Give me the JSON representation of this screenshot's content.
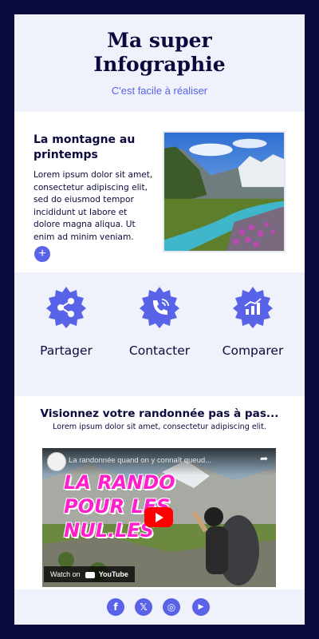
{
  "header": {
    "title_line1": "Ma super",
    "title_line2": "Infographie",
    "subtitle": "C'est facile à réaliser"
  },
  "article": {
    "title": "La montagne au printemps",
    "body": "Lorem ipsum dolor sit amet, consectetur adipiscing elit, sed do eiusmod tempor incididunt ut labore et dolore magna aliqua. Ut enim ad minim veniam.",
    "more_icon": "+"
  },
  "features": [
    {
      "label": "Partager",
      "icon": "share-icon"
    },
    {
      "label": "Contacter",
      "icon": "phone-icon"
    },
    {
      "label": "Comparer",
      "icon": "chart-icon"
    }
  ],
  "video_section": {
    "title": "Visionnez votre randonnée pas à pas...",
    "description": "Lorem ipsum dolor sit amet, consectetur adipiscing elit.",
    "video": {
      "channel_title": "La randonnée quand on y connaît queud...",
      "thumbnail_line1": "LA RANDO",
      "thumbnail_line2": "POUR LES",
      "thumbnail_line3": "NUL.LES",
      "watch_on": "Watch on",
      "platform": "YouTube"
    }
  },
  "footer": {
    "social": [
      {
        "name": "facebook-icon",
        "glyph": "f"
      },
      {
        "name": "x-icon",
        "glyph": "𝕏"
      },
      {
        "name": "instagram-icon",
        "glyph": "◎"
      },
      {
        "name": "youtube-icon",
        "glyph": "▶"
      }
    ]
  },
  "colors": {
    "background": "#0b0a3d",
    "accent": "#5863e8",
    "light_section": "#f0f2fb",
    "text": "#0b0a3d",
    "thumbnail_text": "#ff1ecc"
  }
}
